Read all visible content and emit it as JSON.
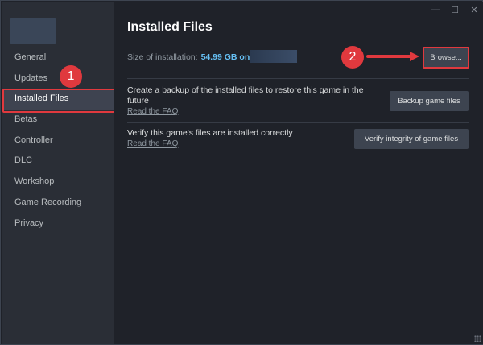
{
  "window": {
    "controls": [
      "—",
      "☐",
      "✕"
    ]
  },
  "sidebar": {
    "items": [
      {
        "label": "General"
      },
      {
        "label": "Updates"
      },
      {
        "label": "Installed Files"
      },
      {
        "label": "Betas"
      },
      {
        "label": "Controller"
      },
      {
        "label": "DLC"
      },
      {
        "label": "Workshop"
      },
      {
        "label": "Game Recording"
      },
      {
        "label": "Privacy"
      }
    ]
  },
  "main": {
    "title": "Installed Files",
    "size_label": "Size of installation:",
    "size_value": "54.99 GB on",
    "browse_label": "Browse...",
    "backup": {
      "text": "Create a backup of the installed files to restore this game in the future",
      "faq": "Read the FAQ",
      "button": "Backup game files"
    },
    "verify": {
      "text": "Verify this game's files are installed correctly",
      "faq": "Read the FAQ",
      "button": "Verify integrity of game files"
    }
  },
  "annotations": {
    "step1": "1",
    "step2": "2"
  },
  "colors": {
    "accent": "#66c0f4",
    "highlight": "#e0393e"
  }
}
